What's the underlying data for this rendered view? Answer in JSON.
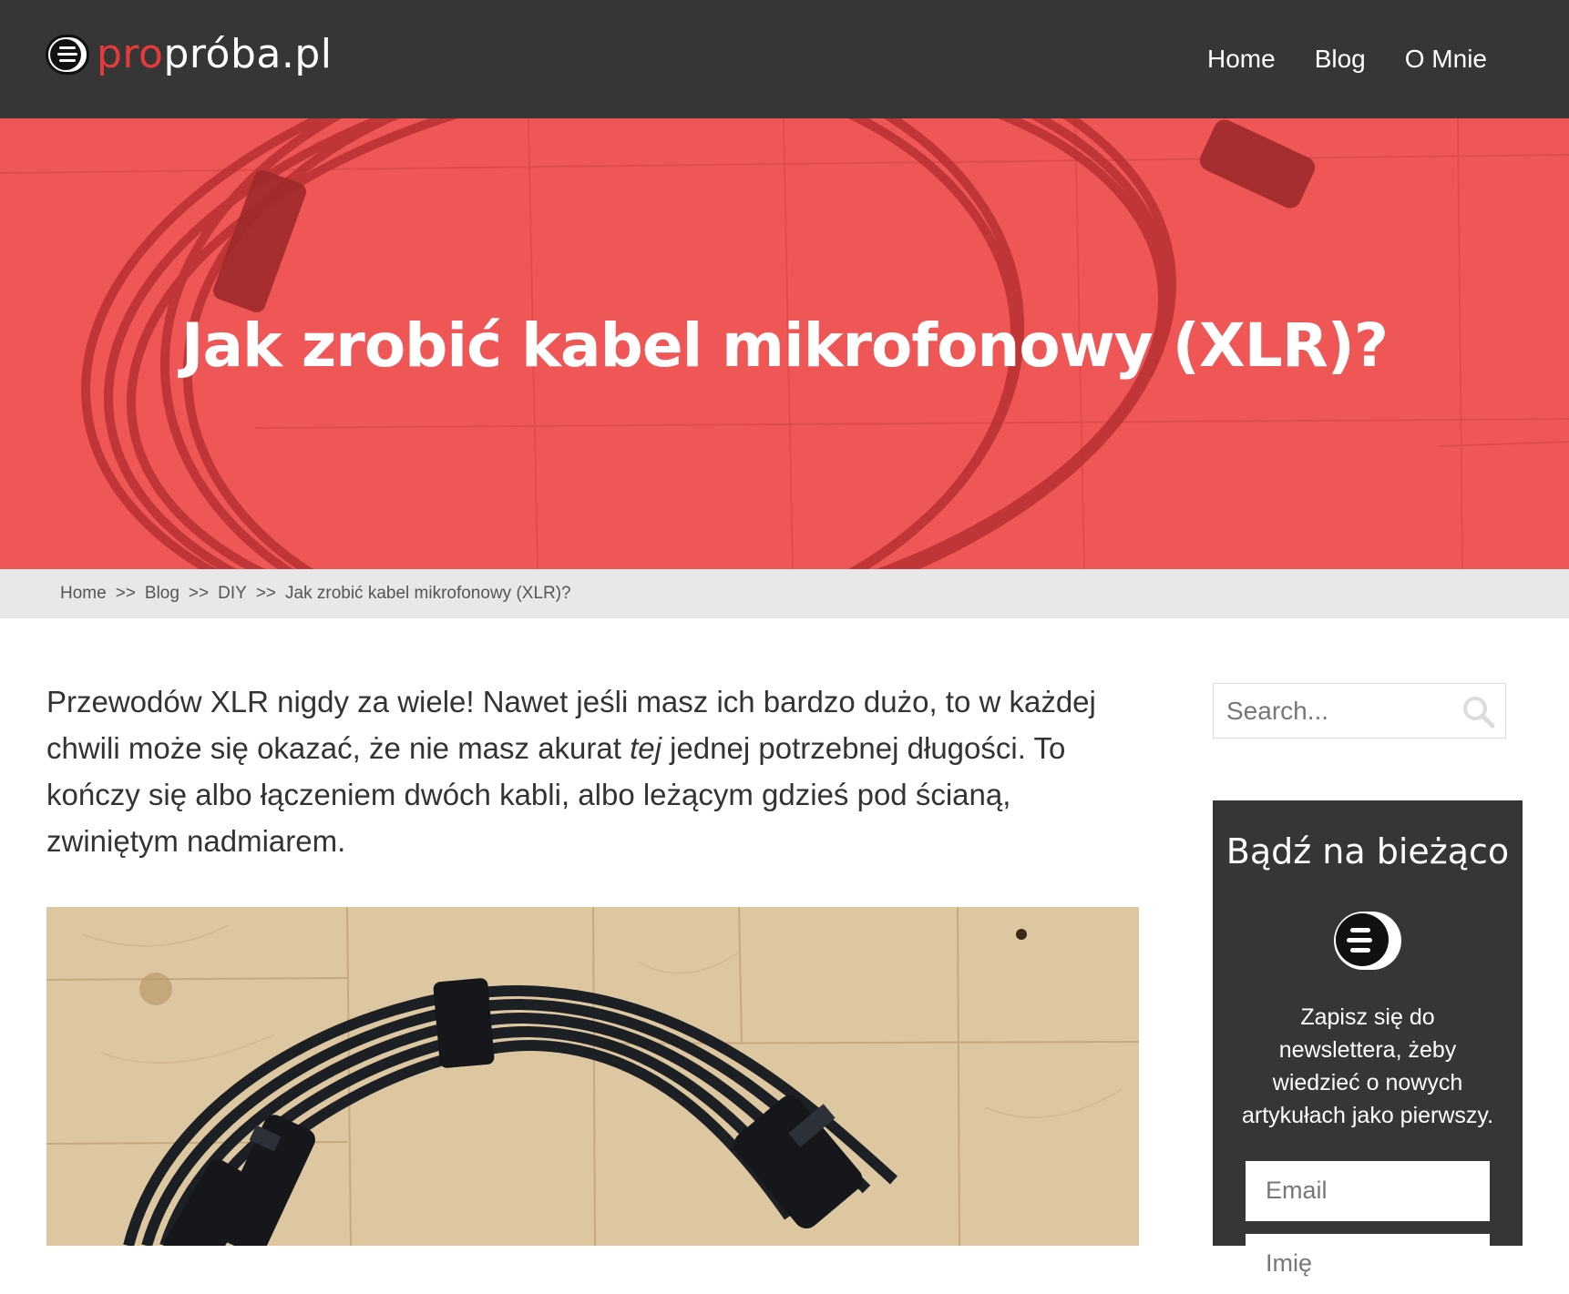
{
  "header": {
    "logo_pro": "pro",
    "logo_rest": "próba.pl",
    "nav": [
      {
        "label": "Home"
      },
      {
        "label": "Blog"
      },
      {
        "label": "O Mnie"
      }
    ]
  },
  "hero": {
    "title": "Jak zrobić kabel mikrofonowy (XLR)?"
  },
  "breadcrumb": {
    "items": [
      "Home",
      "Blog",
      "DIY",
      "Jak zrobić kabel mikrofonowy (XLR)?"
    ],
    "separator": ">>"
  },
  "article": {
    "intro_part1": "Przewodów XLR nigdy za wiele! Nawet jeśli masz ich bardzo dużo, to w każdej chwili może się okazać, że nie masz akurat ",
    "intro_em": "tej",
    "intro_part2": " jednej potrzebnej długości. To kończy się albo łączeniem dwóch kabli, albo leżącym gdzieś pod ścianą, zwiniętym nadmiarem."
  },
  "sidebar": {
    "search_placeholder": "Search...",
    "newsletter": {
      "title": "Bądź na bieżąco",
      "text": "Zapisz się do newslettera, żeby wiedzieć o nowych artykułach jako pierwszy.",
      "email_placeholder": "Email",
      "name_placeholder": "Imię"
    }
  },
  "colors": {
    "header_bg": "#363636",
    "accent_red": "#e63a3a",
    "hero_overlay": "#ef5656",
    "breadcrumb_bg": "#e8e8e8"
  },
  "icons": [
    "logo-icon",
    "search-icon",
    "newsletter-logo-icon"
  ]
}
